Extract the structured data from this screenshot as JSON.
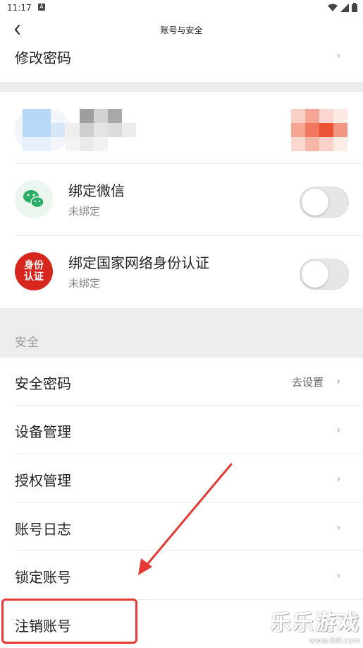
{
  "status_bar": {
    "time": "11:17",
    "a_badge": "A"
  },
  "nav": {
    "title": "账号与安全"
  },
  "change_password": {
    "label": "修改密码"
  },
  "bind_wechat": {
    "title": "绑定微信",
    "status": "未绑定"
  },
  "bind_national_id": {
    "title": "绑定国家网络身份认证",
    "status": "未绑定",
    "icon_text_top": "身份",
    "icon_text_bottom": "认证"
  },
  "security": {
    "section_label": "安全",
    "items": [
      {
        "label": "安全密码",
        "value": "去设置"
      },
      {
        "label": "设备管理"
      },
      {
        "label": "授权管理"
      },
      {
        "label": "账号日志"
      },
      {
        "label": "锁定账号"
      },
      {
        "label": "注销账号"
      }
    ]
  },
  "watermark": {
    "brand": "乐乐游戏",
    "url": "www.6lll.com"
  },
  "colors": {
    "accent_red": "#e53935",
    "wechat_green": "#2aae67",
    "toggle_off": "#e6e6e6"
  }
}
